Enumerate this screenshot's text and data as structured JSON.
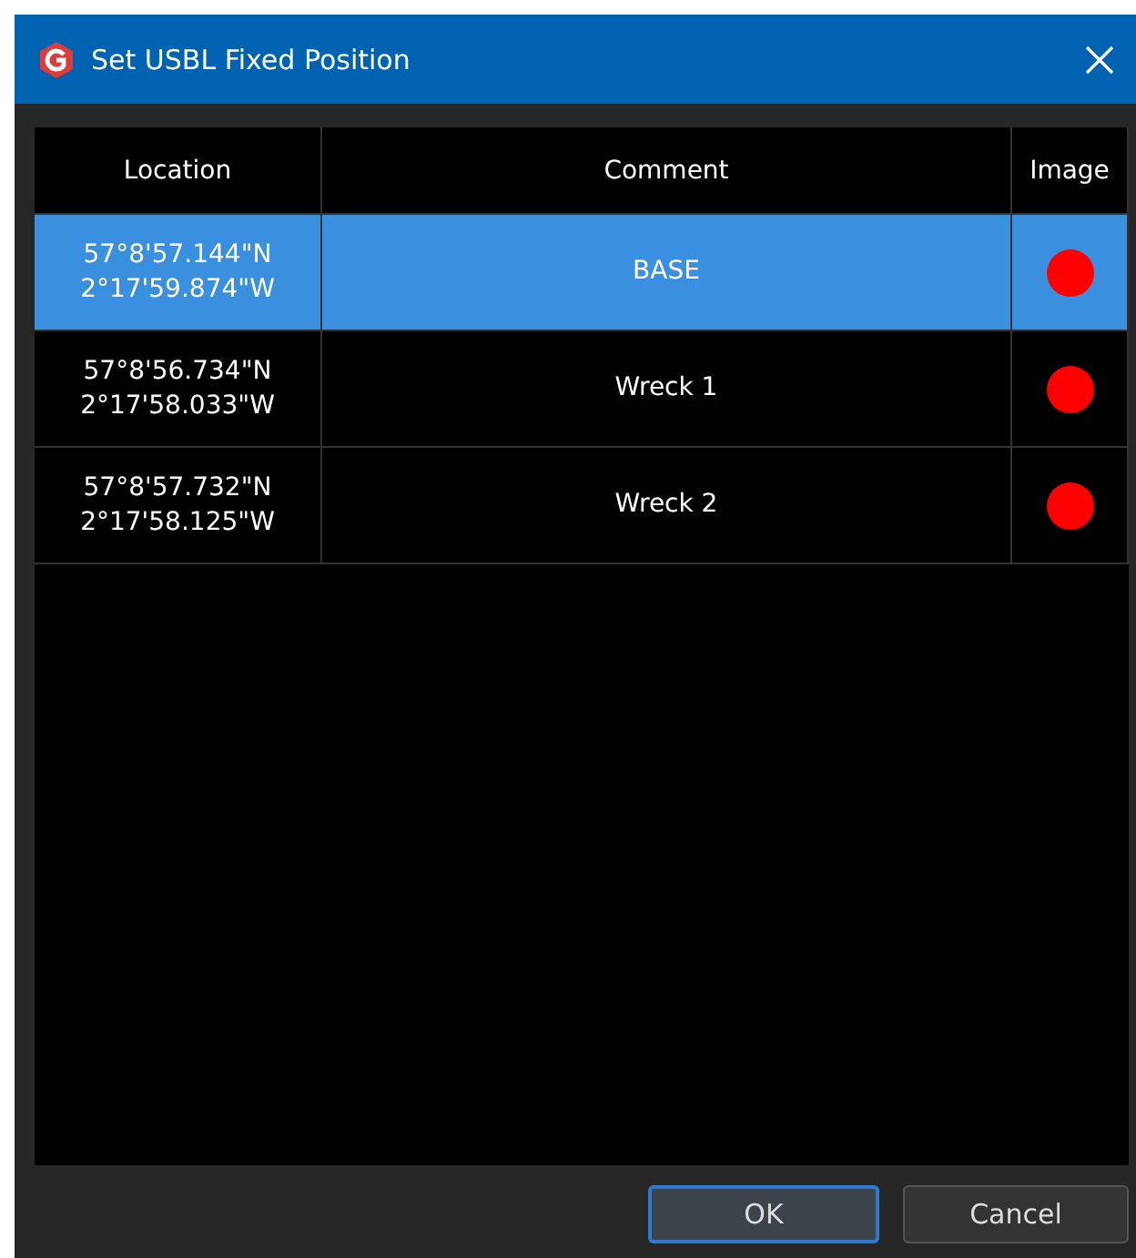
{
  "window": {
    "title": "Set USBL Fixed Position"
  },
  "table": {
    "columns": [
      "Location",
      "Comment",
      "Image"
    ],
    "rows": [
      {
        "location": [
          "57°8'57.144\"N",
          "2°17'59.874\"W"
        ],
        "comment": "BASE",
        "selected": true,
        "color": "#ff0000"
      },
      {
        "location": [
          "57°8'56.734\"N",
          "2°17'58.033\"W"
        ],
        "comment": "Wreck 1",
        "selected": false,
        "color": "#ff0000"
      },
      {
        "location": [
          "57°8'57.732\"N",
          "2°17'58.125\"W"
        ],
        "comment": "Wreck 2",
        "selected": false,
        "color": "#ff0000"
      }
    ]
  },
  "buttons": [
    {
      "label": "OK",
      "default": true
    },
    {
      "label": "Cancel",
      "default": false
    }
  ]
}
